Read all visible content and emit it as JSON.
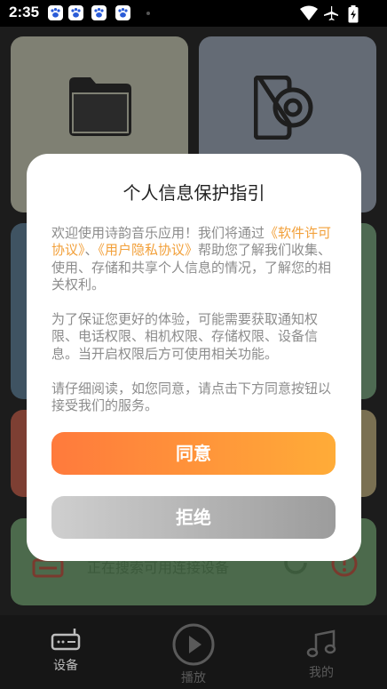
{
  "status_bar": {
    "time": "2:35",
    "notification_icons": [
      "baidu-paw-icon",
      "baidu-paw-icon",
      "baidu-paw-icon",
      "baidu-paw-icon"
    ],
    "right_icons": [
      "wifi-icon",
      "airplane-mode-icon",
      "battery-charging-icon"
    ]
  },
  "background_app": {
    "tiles": [
      {
        "icon": "folder-icon",
        "color": "#7f8073"
      },
      {
        "icon": "music-disc-icon",
        "color": "#646b75"
      },
      {
        "color": "#3f5362"
      },
      {
        "color": "#4e6a52"
      },
      {
        "color": "#7d3f33"
      },
      {
        "color": "#7a7052"
      }
    ],
    "scan_bar": {
      "text": "正在搜索可用连接设备",
      "color": "#4c6a4c"
    },
    "bottom_nav": [
      {
        "label": "设备",
        "icon": "radio-device-icon",
        "active": true
      },
      {
        "label": "播放",
        "icon": "play-circle-icon",
        "active": false
      },
      {
        "label": "我的",
        "icon": "music-note-icon",
        "active": false
      }
    ]
  },
  "dialog": {
    "title": "个人信息保护指引",
    "intro": "欢迎使用诗韵音乐应用！我们将通过",
    "link_license": "《软件许可协议》",
    "separator": "、",
    "link_privacy": "《用户隐私协议》",
    "intro_rest": "帮助您了解我们收集、使用、存储和共享个人信息的情况，了解您的相关权利。",
    "paragraph2": "为了保证您更好的体验，可能需要获取通知权限、电话权限、相机权限、存储权限、设备信息。当开启权限后方可使用相关功能。",
    "paragraph3": "请仔细阅读，如您同意，请点击下方同意按钮以接受我们的服务。",
    "agree_label": "同意",
    "refuse_label": "拒绝",
    "colors": {
      "link": "#f2a03a",
      "agree_start": "#ff7a3c",
      "agree_end": "#ffac38",
      "refuse_start": "#cfcfcf",
      "refuse_end": "#9c9c9c"
    }
  }
}
